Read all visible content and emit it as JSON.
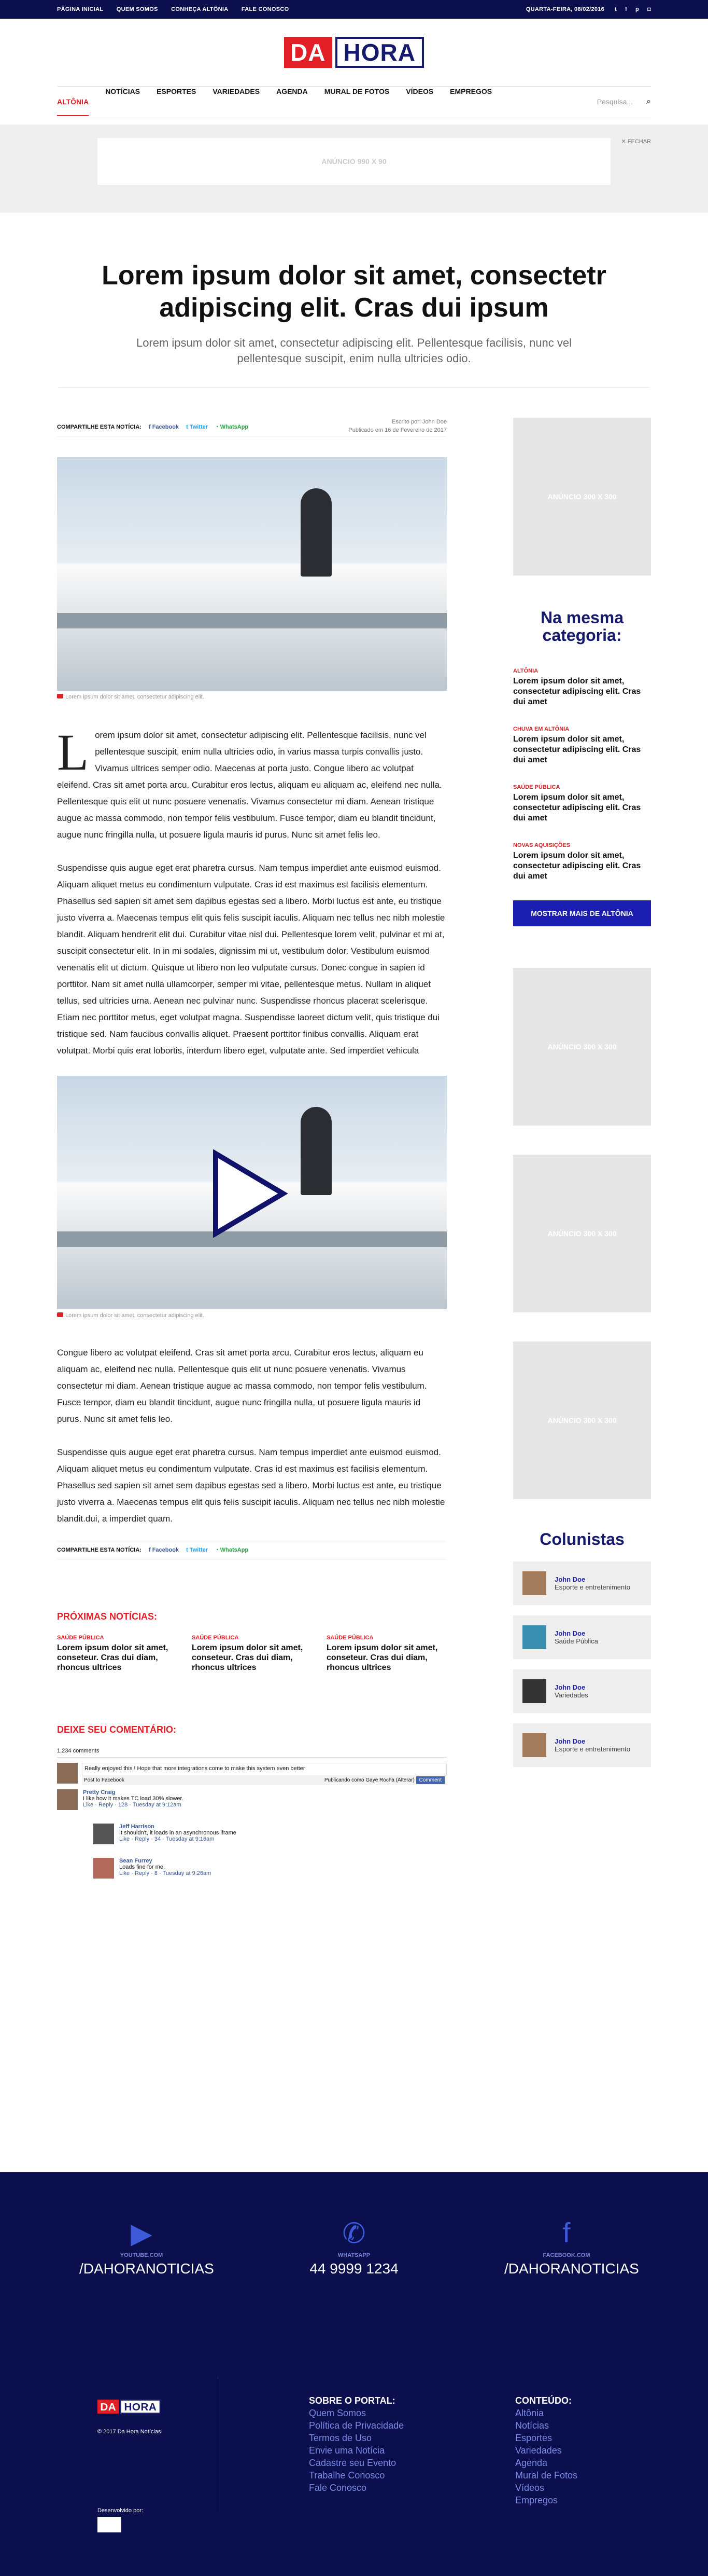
{
  "topbar": {
    "links": [
      "PÁGINA INICIAL",
      "QUEM SOMOS",
      "CONHEÇA ALTÔNIA",
      "FALE CONOSCO"
    ],
    "date": "QUARTA-FEIRA, 08/02/2016",
    "social_icons": [
      "twitter-icon",
      "facebook-icon",
      "pinterest-icon",
      "instagram-icon"
    ]
  },
  "logo": {
    "part1": "DA",
    "part2": "HORA"
  },
  "nav": {
    "items": [
      "ALTÔNIA",
      "NOTÍCIAS",
      "ESPORTES",
      "VARIEDADES",
      "AGENDA",
      "MURAL DE FOTOS",
      "VÍDEOS",
      "EMPREGOS"
    ],
    "search_placeholder": "Pesquisa..."
  },
  "ad_top": {
    "label": "ANÚNCIO 990 X 90",
    "close": "FECHAR"
  },
  "article": {
    "title": "Lorem ipsum dolor sit amet, consectetr adipiscing elit. Cras dui ipsum",
    "subtitle": "Lorem ipsum dolor sit amet, consectetur adipiscing elit. Pellentesque facilisis, nunc vel pellentesque suscipit, enim nulla ultricies odio.",
    "share_label": "COMPARTILHE ESTA NOTÍCIA:",
    "share": {
      "facebook": "Facebook",
      "twitter": "Twitter",
      "whatsapp": "WhatsApp"
    },
    "author": "Escrito por: John Doe",
    "published": "Publicado em 16 de Fevereiro de 2017",
    "caption1": "Lorem ipsum dolor sit amet, consectetur adipiscing elit.",
    "caption2": "Lorem ipsum dolor sit amet, consectetur adipiscing elit.",
    "dropcap": "L",
    "para1": "orem ipsum dolor sit amet, consectetur adipiscing elit. Pellentesque facilisis, nunc vel pellentesque suscipit, enim nulla ultricies odio, in varius massa turpis convallis justo. Vivamus ultrices semper odio. Maecenas at porta justo. Congue libero ac volutpat eleifend. Cras sit amet porta arcu. Curabitur eros lectus, aliquam eu aliquam ac, eleifend nec nulla. Pellentesque quis elit ut nunc posuere venenatis. Vivamus consectetur mi diam. Aenean tristique augue ac massa commodo, non tempor felis vestibulum. Fusce tempor, diam eu blandit tincidunt, augue nunc fringilla nulla, ut posuere ligula mauris id purus. Nunc sit amet felis leo.",
    "para2": "Suspendisse quis augue eget erat pharetra cursus. Nam tempus imperdiet ante euismod euismod. Aliquam aliquet metus eu condimentum vulputate. Cras id est maximus est facilisis elementum. Phasellus sed sapien sit amet sem dapibus egestas sed a libero. Morbi luctus est ante, eu tristique justo viverra a. Maecenas tempus elit quis felis suscipit iaculis. Aliquam nec tellus nec nibh molestie blandit. Aliquam hendrerit elit dui. Curabitur vitae nisl dui. Pellentesque lorem velit, pulvinar et mi at, suscipit consectetur elit. In in mi sodales, dignissim mi ut, vestibulum dolor. Vestibulum euismod venenatis elit ut dictum. Quisque ut libero non leo vulputate cursus. Donec congue in sapien id porttitor. Nam sit amet nulla ullamcorper, semper mi vitae, pellentesque metus. Nullam in aliquet tellus, sed ultricies urna. Aenean nec pulvinar nunc. Suspendisse rhoncus placerat scelerisque. Etiam nec porttitor metus, eget volutpat magna. Suspendisse laoreet dictum velit, quis tristique dui tristique sed. Nam faucibus convallis aliquet. Praesent porttitor finibus convallis. Aliquam erat volutpat. Morbi quis erat lobortis, interdum libero eget, vulputate ante. Sed imperdiet vehicula",
    "para3": "Congue libero ac volutpat eleifend. Cras sit amet porta arcu. Curabitur eros lectus, aliquam eu aliquam ac, eleifend nec nulla. Pellentesque quis elit ut nunc posuere venenatis. Vivamus consectetur mi diam. Aenean tristique augue ac massa commodo, non tempor felis vestibulum. Fusce tempor, diam eu blandit tincidunt, augue nunc fringilla nulla, ut posuere ligula mauris id purus. Nunc sit amet felis leo.",
    "para4": "Suspendisse quis augue eget erat pharetra cursus. Nam tempus imperdiet ante euismod euismod. Aliquam aliquet metus eu condimentum vulputate. Cras id est maximus est facilisis elementum. Phasellus sed sapien sit amet sem dapibus egestas sed a libero. Morbi luctus est ante, eu tristique justo viverra a. Maecenas tempus elit quis felis suscipit iaculis. Aliquam nec tellus nec nibh molestie blandit.dui, a imperdiet quam."
  },
  "next": {
    "title": "PRÓXIMAS NOTÍCIAS:",
    "items": [
      {
        "tag": "SAÚDE PÚBLICA",
        "title": "Lorem ipsum dolor sit amet, conseteur. Cras dui diam, rhoncus ultrices"
      },
      {
        "tag": "SAÚDE PÚBLICA",
        "title": "Lorem ipsum dolor sit amet, conseteur. Cras dui diam, rhoncus ultrices"
      },
      {
        "tag": "SAÚDE PÚBLICA",
        "title": "Lorem ipsum dolor sit amet, conseteur. Cras dui diam, rhoncus ultrices"
      }
    ]
  },
  "comments": {
    "title": "DEIXE SEU COMENTÁRIO:",
    "count": "1,234 comments",
    "input": "Really enjoyed this ! Hope that more integrations come to make this system even better",
    "post_facebook": "Post to Facebook",
    "posting_as": "Publicando como Gaye Rocha (Alterar)",
    "submit": "Comment",
    "list": [
      {
        "name": "Pretty Craig",
        "text": "I like how it makes TC load 30% slower.",
        "meta": "Like · Reply · 128 · Tuesday at 9:12am"
      },
      {
        "name": "Jeff Harrison",
        "text": "It shouldn't, it loads in an asynchronous iframe",
        "meta": "Like · Reply · 34 · Tuesday at 9:16am"
      },
      {
        "name": "Sean Furrey",
        "text": "Loads fine for me.",
        "meta": "Like · Reply · 8 · Tuesday at 9:26am"
      }
    ]
  },
  "sidebar": {
    "ad": "ANÚNCIO 300 X 300",
    "related_title": "Na mesma categoria:",
    "related": [
      {
        "cat": "ALTÔNIA",
        "title": "Lorem ipsum dolor sit amet, consectetur adipiscing elit. Cras dui amet"
      },
      {
        "cat": "CHUVA EM ALTÔNIA",
        "title": "Lorem ipsum dolor sit amet, consectetur adipiscing elit. Cras dui amet"
      },
      {
        "cat": "SAÚDE PÚBLICA",
        "title": "Lorem ipsum dolor sit amet, consectetur adipiscing elit. Cras dui amet"
      },
      {
        "cat": "NOVAS AQUISIÇÕES",
        "title": "Lorem ipsum dolor sit amet, consectetur adipiscing elit. Cras dui amet"
      }
    ],
    "more_button": "MOSTRAR MAIS DE ALTÔNIA",
    "columnists_title": "Colunistas",
    "columnists": [
      {
        "name": "John Doe",
        "section": "Esporte e entretenimento"
      },
      {
        "name": "John Doe",
        "section": "Saúde Pública"
      },
      {
        "name": "John Doe",
        "section": "Variedades"
      },
      {
        "name": "John Doe",
        "section": "Esporte e entretenimento"
      }
    ]
  },
  "social": [
    {
      "icon": "youtube-icon",
      "label": "YOUTUBE.COM",
      "value": "/DAHORANOTICIAS"
    },
    {
      "icon": "whatsapp-icon",
      "label": "WHATSAPP",
      "value": "44 9999 1234"
    },
    {
      "icon": "facebook-icon",
      "label": "FACEBOOK.COM",
      "value": "/DAHORANOTICIAS"
    }
  ],
  "footer": {
    "copyright": "© 2017 Da Hora Notícias",
    "dev": "Desenvolvido por:",
    "about_title": "SOBRE O PORTAL:",
    "about": [
      "Quem Somos",
      "Política de Privacidade",
      "Termos de Uso",
      "Envie uma Notícia",
      "Cadastre seu Evento",
      "Trabalhe Conosco",
      "Fale Conosco"
    ],
    "content_title": "CONTEÚDO:",
    "content": [
      "Altônia",
      "Notícias",
      "Esportes",
      "Variedades",
      "Agenda",
      "Mural de Fotos",
      "Vídeos",
      "Empregos"
    ]
  }
}
